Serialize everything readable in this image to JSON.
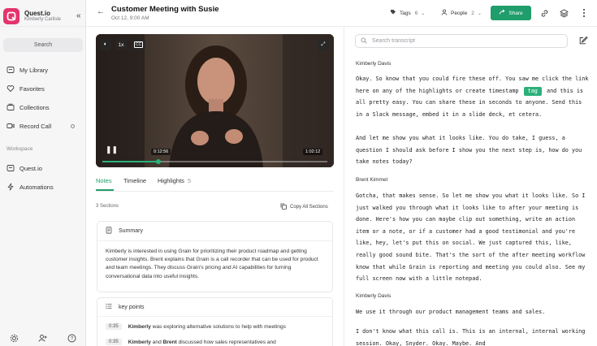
{
  "sidebar": {
    "brand_name": "Quest.io",
    "user_name": "Kimberly Carlisle",
    "search_label": "Search",
    "items": [
      {
        "label": "My Library"
      },
      {
        "label": "Favorites"
      },
      {
        "label": "Collections"
      },
      {
        "label": "Record Call"
      }
    ],
    "workspace_label": "Workspace",
    "workspace_items": [
      {
        "label": "Quest.io"
      },
      {
        "label": "Automations"
      }
    ],
    "brand_color": "#e5346d"
  },
  "header": {
    "title": "Customer Meeting with Susie",
    "subtitle": "Oct 12, 9:00 AM",
    "tags_label": "Tags",
    "tags_count": "6",
    "people_label": "People",
    "people_count": "2",
    "share_label": "Share",
    "accent_color": "#1f9d6a"
  },
  "video": {
    "speed": "1x",
    "current_time": "0:12:56",
    "duration": "1:02:12",
    "progress": 0.25
  },
  "notes": {
    "tabs": [
      {
        "label": "Notes"
      },
      {
        "label": "Timeline"
      },
      {
        "label": "Highlights",
        "count": "5"
      }
    ],
    "sections_count": "3 Sections",
    "copy_all_label": "Copy All Sections",
    "summary_title": "Summary",
    "summary_text": "Kimberly is interested in using Grain for prioritizing their product roadmap and getting customer insights. Brent explains that Grain is a call recorder that can be used for product and team meetings. They discuss Grain's pricing and AI capabilities for turning conversational data into useful insights.",
    "key_points_title": "key points",
    "key_points": [
      {
        "time": "0:35",
        "speaker": "Kimberly",
        "text": " was exploring alternative solutions to help with meetings"
      },
      {
        "time": "0:35",
        "speaker": "Kimberly",
        "mid": " and ",
        "speaker2": "Brent",
        "text": " discussed how sales representatives and"
      }
    ]
  },
  "transcript": {
    "search_placeholder": "Search transcript",
    "blocks": [
      {
        "speaker": "Kimberly Davis",
        "p1_before": "Okay. So know that you could fire these off. You saw me click the link here on any of the highlights or create timestamp",
        "tag": "tag",
        "p1_after": "and this is all pretty easy. You can share these in seconds to anyone. Send this in a Slack message, embed it in a slide deck, et cetera.",
        "p2": "And let me show you what it looks like. You do take, I guess, a question I should ask before I show you the next step is, how do you take notes today?"
      },
      {
        "speaker": "Brent Kimmel",
        "p1": "Gotcha, that makes sense. So let me show you what it looks like. So I just walked you through what it looks like to after your meeting is done. Here's how you can maybe clip out something, write an action item or a note, or if a customer had a good testimonial and you're like, hey, let's put this on social. We just captured this, like, really good sound bite. That's the sort of the after meeting workflow know that while Grain is reporting and meeting you could also. See my full screen now with a little notepad."
      },
      {
        "speaker": "Kimberly Davis",
        "p1": "We use it through our product management teams and sales.",
        "p2": "I don't know what this call is. This is an internal, internal working session. Okay, Snyder. Okay. Maybe. And"
      }
    ]
  }
}
